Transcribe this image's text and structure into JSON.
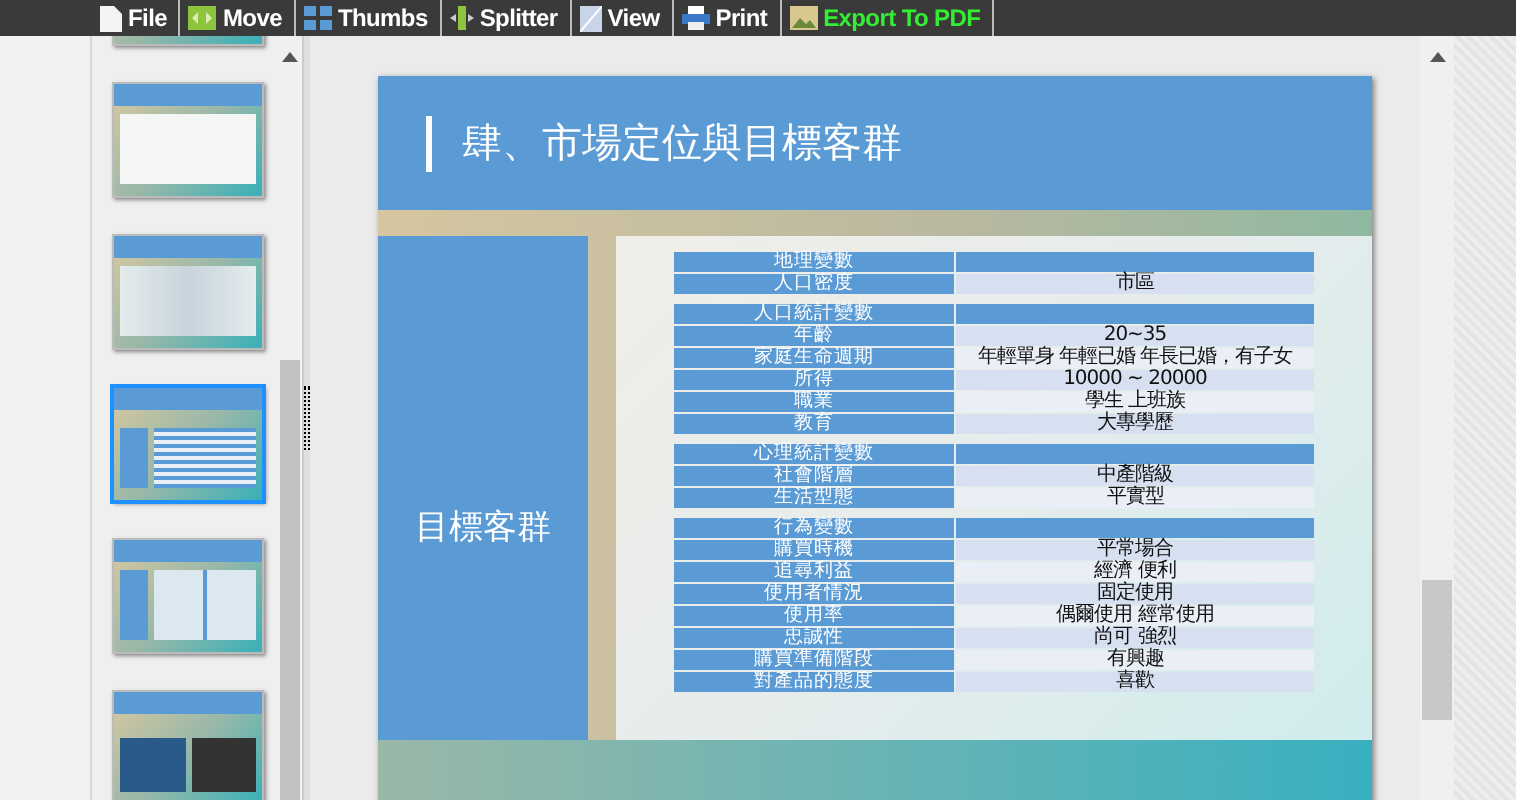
{
  "toolbar": [
    {
      "label": "File",
      "highlight": false
    },
    {
      "label": "Move",
      "highlight": false
    },
    {
      "label": "Thumbs",
      "highlight": false
    },
    {
      "label": "Splitter",
      "highlight": false
    },
    {
      "label": "View",
      "highlight": false
    },
    {
      "label": "Print",
      "highlight": false
    },
    {
      "label": "Export To PDF",
      "highlight": true
    }
  ],
  "thumbnails": [
    {
      "kind": "cut",
      "selected": false
    },
    {
      "kind": "banner",
      "selected": false
    },
    {
      "kind": "map",
      "selected": false
    },
    {
      "kind": "table",
      "selected": true
    },
    {
      "kind": "grid",
      "selected": false
    },
    {
      "kind": "photos",
      "selected": false
    }
  ],
  "slide": {
    "title": "肆、市場定位與目標客群",
    "side_label": "目標客群",
    "groups": [
      {
        "heading": "地理變數",
        "rows": [
          [
            "人口密度",
            "市區"
          ]
        ]
      },
      {
        "heading": "人口統計變數",
        "rows": [
          [
            "年齡",
            "20~35"
          ],
          [
            "家庭生命週期",
            "年輕單身 年輕已婚 年長已婚，有子女"
          ],
          [
            "所得",
            "10000 ~ 20000"
          ],
          [
            "職業",
            "學生 上班族"
          ],
          [
            "教育",
            "大專學歷"
          ]
        ]
      },
      {
        "heading": "心理統計變數",
        "rows": [
          [
            "社會階層",
            "中產階級"
          ],
          [
            "生活型態",
            "平實型"
          ]
        ]
      },
      {
        "heading": "行為變數",
        "rows": [
          [
            "購買時機",
            "平常場合"
          ],
          [
            "追尋利益",
            "經濟 便利"
          ],
          [
            "使用者情況",
            "固定使用"
          ],
          [
            "使用率",
            "偶爾使用 經常使用"
          ],
          [
            "忠誠性",
            "尚可 強烈"
          ],
          [
            "購買準備階段",
            "有興趣"
          ],
          [
            "對產品的態度",
            "喜歡"
          ]
        ]
      }
    ]
  }
}
